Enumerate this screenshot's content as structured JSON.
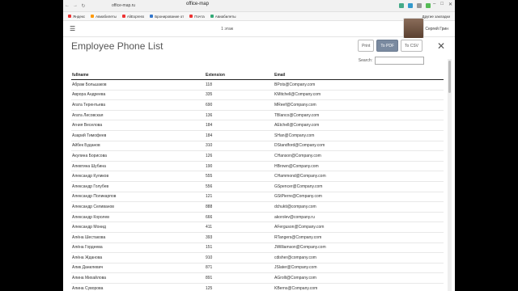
{
  "browser": {
    "url": "office-map.ru",
    "tab_title": "office-map",
    "bookmarks": [
      {
        "label": "Яндекс",
        "color": "#e33"
      },
      {
        "label": "Авиабилеты",
        "color": "#f90"
      },
      {
        "label": "AliExpress",
        "color": "#e33"
      },
      {
        "label": "Бронирование от",
        "color": "#37c"
      },
      {
        "label": "Почта",
        "color": "#e33"
      },
      {
        "label": "Авиабилеты",
        "color": "#3a7"
      }
    ],
    "other_bookmarks": "Другие закладки"
  },
  "appbar": {
    "floor": "1 этаж",
    "user": "Сергей Грин"
  },
  "panel": {
    "title": "Employee Phone List",
    "print_label": "Print",
    "pdf_label": "To PDF",
    "csv_label": "To CSV",
    "close_glyph": "✕",
    "search_label": "Search:"
  },
  "table": {
    "headers": {
      "fullname": "fullname",
      "extension": "Extension",
      "email": "Email"
    },
    "rows": [
      {
        "name": "Абрам Большаков",
        "ext": "118",
        "email": "BPots@Company.com"
      },
      {
        "name": "Аврора Андреева",
        "ext": "335",
        "email": "KMitchell@Company.com"
      },
      {
        "name": "Агата Терентьева",
        "ext": "690",
        "email": "MReef@Company.com"
      },
      {
        "name": "Агата Лисовская",
        "ext": "136",
        "email": "TBlanco@Company.com"
      },
      {
        "name": "Агния Веселова",
        "ext": "184",
        "email": "AEtchell@Company.com"
      },
      {
        "name": "Азарий Тимофеев",
        "ext": "184",
        "email": "SHan@Company.com"
      },
      {
        "name": "Айбек Буданов",
        "ext": "310",
        "email": "DStandford@Company.com"
      },
      {
        "name": "Акулина Борисова",
        "ext": "126",
        "email": "CHanson@Company.com"
      },
      {
        "name": "Алевтина Шубина",
        "ext": "190",
        "email": "HBrown@Company.com"
      },
      {
        "name": "Александр Куликов",
        "ext": "555",
        "email": "CHammond@Company.com"
      },
      {
        "name": "Александр Голубев",
        "ext": "556",
        "email": "GSpencer@Company.com"
      },
      {
        "name": "Александр Поликарпов",
        "ext": "121",
        "email": "GStPierre@Company.com"
      },
      {
        "name": "Александр Селиванов",
        "ext": "888",
        "email": "dchukti@company.com"
      },
      {
        "name": "Александр Королев",
        "ext": "666",
        "email": "akorolev@company.ru"
      },
      {
        "name": "Александр Монид",
        "ext": "411",
        "email": "AFerguson@Company.com"
      },
      {
        "name": "Алёна Шестакова",
        "ext": "393",
        "email": "RTangers@Company.com"
      },
      {
        "name": "Алёна Гордеева",
        "ext": "151",
        "email": "JWilliamson@Company.com"
      },
      {
        "name": "Алёна Жданова",
        "ext": "910",
        "email": "cdisher@company.com"
      },
      {
        "name": "Алик Данилевич",
        "ext": "871",
        "email": "JSlater@Company.com"
      },
      {
        "name": "Алина Михайлова",
        "ext": "891",
        "email": "AGrolli@Company.com"
      },
      {
        "name": "Алина Суворова",
        "ext": "125",
        "email": "KBerns@Company.com"
      }
    ]
  }
}
